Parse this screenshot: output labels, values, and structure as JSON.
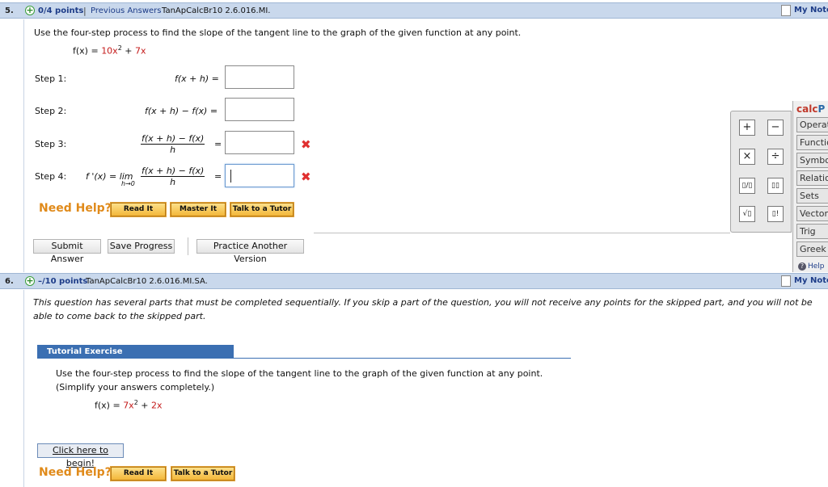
{
  "q5": {
    "number": "5.",
    "points": "0/4 points",
    "separator": "|",
    "previous_answers": "Previous Answers",
    "source": "TanApCalcBr10 2.6.016.MI.",
    "my_notes": "My Notes",
    "instruction": "Use the four-step process to find the slope of the tangent line to the graph of the given function at any point.",
    "function_lhs": "f(x) = ",
    "function_coef": "10x",
    "function_exp": "2",
    "function_plus": " + ",
    "function_term": "7x",
    "step1_label": "Step 1:",
    "step1_expr": "f(x + h) =",
    "step2_label": "Step 2:",
    "step2_expr": "f(x + h) − f(x) =",
    "step3_label": "Step 3:",
    "step3_num": "f(x + h) − f(x)",
    "step3_den": "h",
    "step3_eq": "=",
    "step4_label": "Step 4:",
    "step4_prefix": "f '(x) = lim",
    "step4_sub": "h→0",
    "step4_num": "f(x + h) − f(x)",
    "step4_den": "h",
    "step4_eq": "=",
    "need_help": "Need Help?",
    "read_it": "Read It",
    "master_it": "Master It",
    "talk_tutor": "Talk to a Tutor",
    "submit_answer": "Submit Answer",
    "save_progress": "Save Progress",
    "practice_another": "Practice Another Version",
    "wrong_mark": "✖"
  },
  "calcpad": {
    "title_part": "calc",
    "title_p": "P",
    "buttons": [
      "+",
      "−",
      "×",
      "÷",
      "▯/▯",
      "▯▯",
      "√▯",
      "▯!"
    ],
    "tabs": [
      "Operations",
      "Functions",
      "Symbols",
      "Relations",
      "Sets",
      "Vectors",
      "Trig",
      "Greek"
    ],
    "help": "Help"
  },
  "q6": {
    "number": "6.",
    "points": "–/10 points",
    "source": "TanApCalcBr10 2.6.016.MI.SA.",
    "my_notes": "My Notes",
    "notice": "This question has several parts that must be completed sequentially. If you skip a part of the question, you will not receive any points for the skipped part, and you will not be able to come back to the skipped part.",
    "tutorial_header": "Tutorial Exercise",
    "instruction_1": "Use the four-step process to find the slope of the tangent line to the graph of the given function at any point.",
    "instruction_2": "(Simplify your answers completely.)",
    "function_lhs": "f(x) = ",
    "function_coef": "7x",
    "function_exp": "2",
    "function_plus": " + ",
    "function_term": "2x",
    "begin": "Click here to begin!",
    "need_help": "Need Help?",
    "read_it": "Read It",
    "talk_tutor": "Talk to a Tutor"
  }
}
